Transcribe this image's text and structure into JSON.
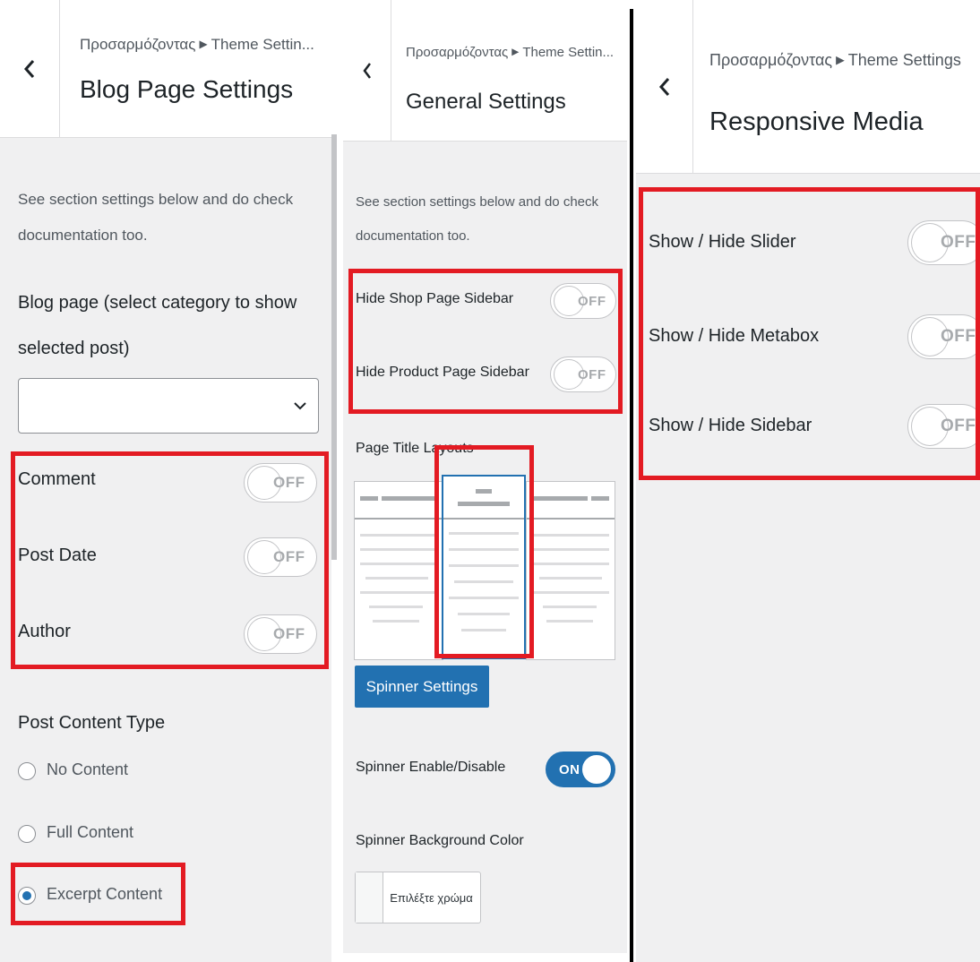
{
  "panel_blog": {
    "breadcrumb_parent": "Προσαρμόζοντας",
    "breadcrumb_child": "Theme Settin...",
    "title": "Blog Page Settings",
    "description_line1": "See section settings below and do check",
    "description_line2": "documentation too.",
    "blog_page_label_line1": "Blog page (select category to show",
    "blog_page_label_line2": "selected post)",
    "category_select_value": "",
    "toggles": [
      {
        "label": "Comment",
        "state": "OFF"
      },
      {
        "label": "Post Date",
        "state": "OFF"
      },
      {
        "label": "Author",
        "state": "OFF"
      }
    ],
    "post_content_type_label": "Post Content Type",
    "radio_options": [
      {
        "label": "No Content",
        "checked": false
      },
      {
        "label": "Full Content",
        "checked": false
      },
      {
        "label": "Excerpt Content",
        "checked": true
      }
    ]
  },
  "panel_general": {
    "breadcrumb_parent": "Προσαρμόζοντας",
    "breadcrumb_child": "Theme Settin...",
    "title": "General Settings",
    "description_line1": "See section settings below and do check",
    "description_line2": "documentation too.",
    "toggles": [
      {
        "label": "Hide Shop Page Sidebar",
        "state": "OFF"
      },
      {
        "label": "Hide Product Page Sidebar",
        "state": "OFF"
      }
    ],
    "page_title_layouts_label": "Page Title Layouts",
    "selected_layout": "center",
    "spinner_settings_button": "Spinner Settings",
    "spinner_enable_label": "Spinner Enable/Disable",
    "spinner_enable_state": "ON",
    "spinner_bg_label": "Spinner Background Color",
    "color_button_label": "Επιλέξτε χρώμα"
  },
  "panel_responsive": {
    "breadcrumb_parent": "Προσαρμόζοντας",
    "breadcrumb_child": "Theme Settings",
    "title": "Responsive Media",
    "toggles": [
      {
        "label": "Show / Hide Slider",
        "state": "OFF"
      },
      {
        "label": "Show / Hide Metabox",
        "state": "OFF"
      },
      {
        "label": "Show / Hide Sidebar",
        "state": "OFF"
      }
    ]
  },
  "colors": {
    "accent": "#2271b1",
    "highlight_box": "#e31b23",
    "panel_bg": "#f0f0f1"
  }
}
